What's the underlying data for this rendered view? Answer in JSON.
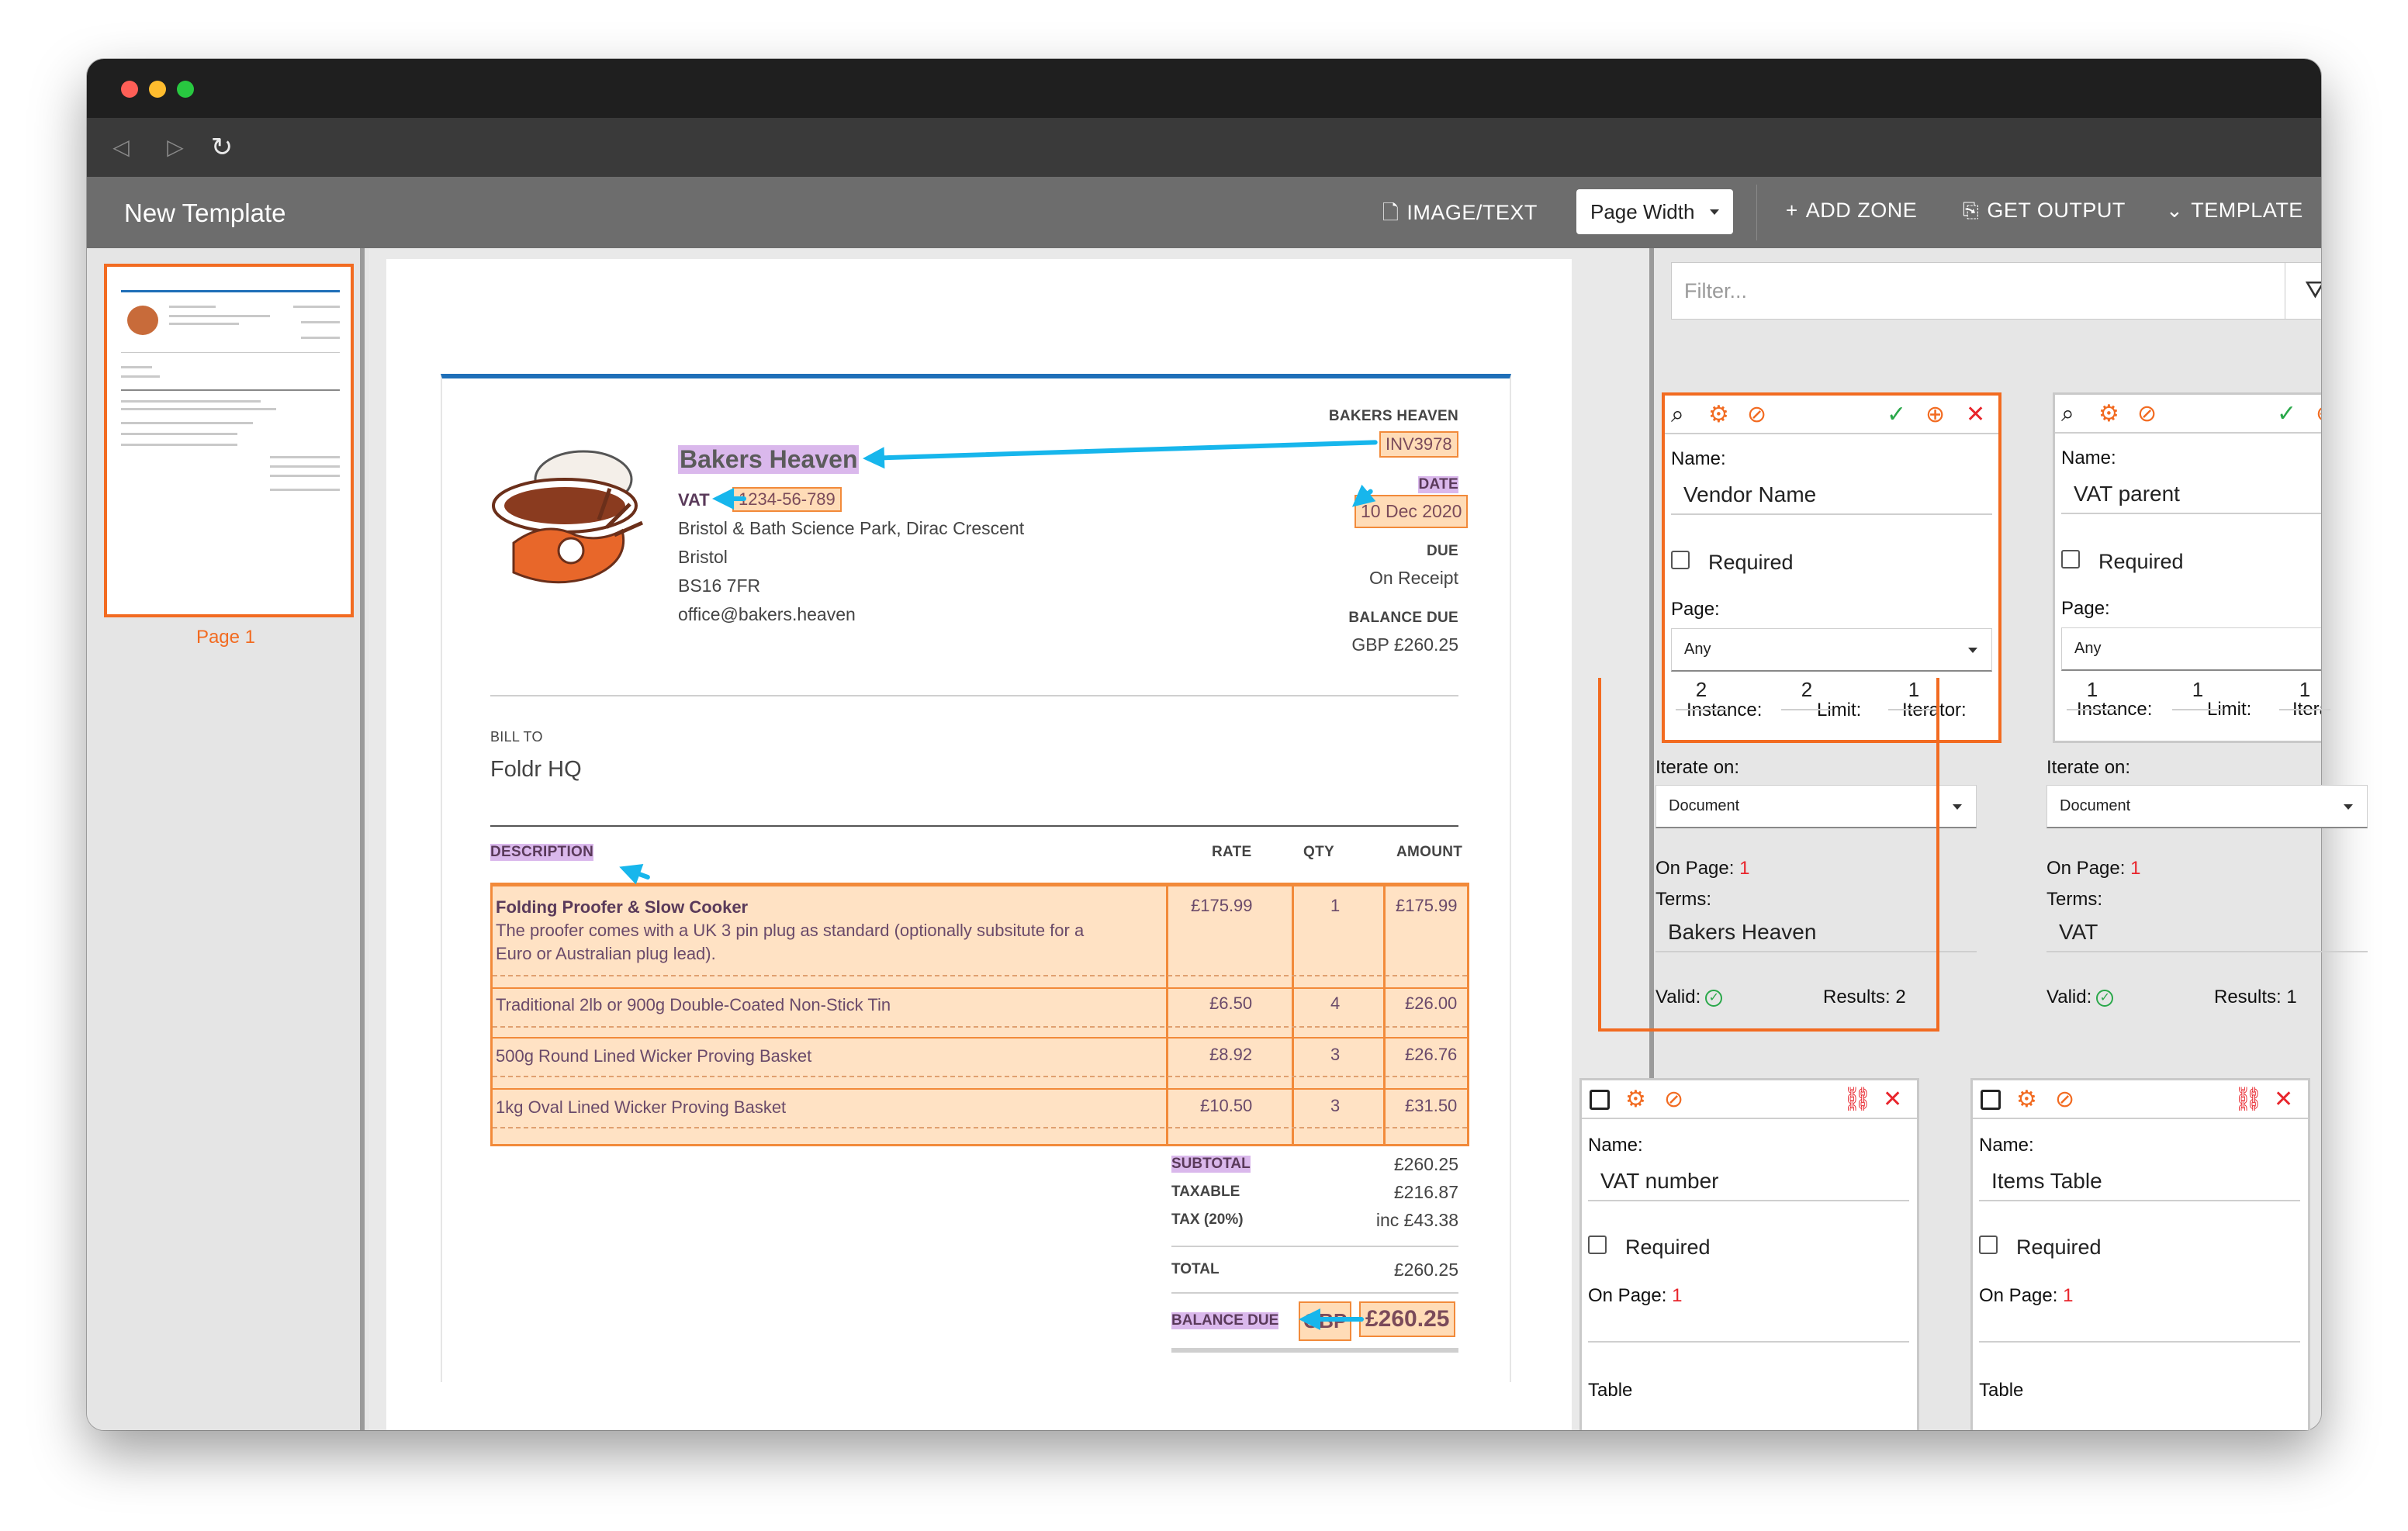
{
  "window": {
    "title": "New Template"
  },
  "toolbar": {
    "image_text": "IMAGE/TEXT",
    "zoom_select": "Page Width",
    "add_zone": "ADD ZONE",
    "get_output": "GET OUTPUT",
    "template": "TEMPLATE"
  },
  "sidebar": {
    "page_label": "Page 1"
  },
  "invoice": {
    "company_header": "BAKERS HEAVEN",
    "invoice_number": "INV3978",
    "vendor_name": "Bakers Heaven",
    "vat_label": "VAT",
    "vat_number": "1234-56-789",
    "address_line1": "Bristol & Bath Science Park, Dirac Crescent",
    "address_line2": "Bristol",
    "address_line3": "BS16 7FR",
    "email": "office@bakers.heaven",
    "date_label": "DATE",
    "date_value": "10 Dec 2020",
    "due_label": "DUE",
    "due_value": "On Receipt",
    "balance_due_label": "BALANCE DUE",
    "balance_due_value": "GBP £260.25",
    "bill_to_label": "BILL TO",
    "bill_to_name": "Foldr HQ",
    "columns": {
      "description": "DESCRIPTION",
      "rate": "RATE",
      "qty": "QTY",
      "amount": "AMOUNT"
    },
    "items": [
      {
        "title": "Folding Proofer & Slow Cooker",
        "detail1": "The proofer comes with a UK 3 pin plug as standard (optionally subsitute for a",
        "detail2": "Euro or Australian plug lead).",
        "rate": "£175.99",
        "qty": "1",
        "amount": "£175.99"
      },
      {
        "title": "Traditional 2lb or 900g Double-Coated Non-Stick Tin",
        "rate": "£6.50",
        "qty": "4",
        "amount": "£26.00"
      },
      {
        "title": "500g Round Lined Wicker Proving Basket",
        "rate": "£8.92",
        "qty": "3",
        "amount": "£26.76"
      },
      {
        "title": "1kg Oval Lined Wicker Proving Basket",
        "rate": "£10.50",
        "qty": "3",
        "amount": "£31.50"
      }
    ],
    "subtotal_label": "SUBTOTAL",
    "subtotal_value": "£260.25",
    "taxable_label": "TAXABLE",
    "taxable_value": "£216.87",
    "tax_label": "TAX (20%)",
    "tax_value": "inc £43.38",
    "total_label": "TOTAL",
    "total_value": "£260.25",
    "final_balance_label": "BALANCE DUE",
    "final_currency": "GBP",
    "final_amount": "£260.25"
  },
  "panel": {
    "filter_placeholder": "Filter...",
    "cards": [
      {
        "name_label": "Name:",
        "name_value": "Vendor Name",
        "required_label": "Required",
        "page_label": "Page:",
        "page_value": "Any",
        "instance_label": "Instance:",
        "instance_value": "2",
        "limit_label": "Limit:",
        "limit_value": "2",
        "iterator_label": "Iterator:",
        "iterator_value": "1",
        "iterate_on_label": "Iterate on:",
        "iterate_on_value": "Document",
        "on_page_label": "On Page:",
        "on_page_value": "1",
        "terms_label": "Terms:",
        "terms_value": "Bakers Heaven",
        "valid_label": "Valid:",
        "results_label": "Results: 2"
      },
      {
        "name_label": "Name:",
        "name_value": "VAT parent",
        "required_label": "Required",
        "page_label": "Page:",
        "page_value": "Any",
        "instance_label": "Instance:",
        "instance_value": "1",
        "limit_label": "Limit:",
        "limit_value": "1",
        "iterator_label": "Iterator:",
        "iterator_value": "1",
        "iterate_on_label": "Iterate on:",
        "iterate_on_value": "Document",
        "on_page_label": "On Page:",
        "on_page_value": "1",
        "terms_label": "Terms:",
        "terms_value": "VAT",
        "valid_label": "Valid:",
        "results_label": "Results: 1"
      },
      {
        "name_label": "Name:",
        "name_value": "VAT number",
        "required_label": "Required",
        "on_page_label": "On Page:",
        "on_page_value": "1",
        "table_label": "Table"
      },
      {
        "name_label": "Name:",
        "name_value": "Items Table",
        "required_label": "Required",
        "on_page_label": "On Page:",
        "on_page_value": "1",
        "table_label": "Table"
      }
    ]
  },
  "colors": {
    "accent": "#f26b21",
    "highlight_blue": "#17b6ec",
    "valid_green": "#2aa84a",
    "close_red": "#e8242b"
  }
}
